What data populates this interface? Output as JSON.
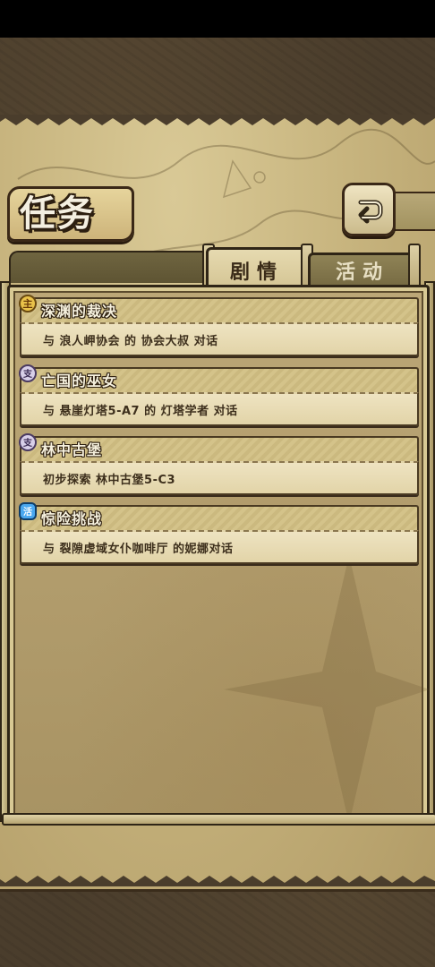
{
  "header": {
    "title": "任务",
    "back_icon": "return-arrow-icon"
  },
  "tabs": [
    {
      "label": "剧情",
      "active": true
    },
    {
      "label": "活动",
      "active": false
    }
  ],
  "quests": [
    {
      "name": "深渊的裁决",
      "description": "与 浪人岬协会 的 协会大叔 对话",
      "icon": "main-quest-icon",
      "icon_color": "#c99a2e"
    },
    {
      "name": "亡国的巫女",
      "description": "与 悬崖灯塔5-A7 的 灯塔学者 对话",
      "icon": "side-quest-icon",
      "icon_color": "#b8a8d8"
    },
    {
      "name": "林中古堡",
      "description": "初步探索 林中古堡5-C3",
      "icon": "side-quest-icon",
      "icon_color": "#b8a8d8"
    },
    {
      "name": "惊险挑战",
      "description": "与 裂隙虚域女仆咖啡厅 的妮娜对话",
      "icon": "challenge-quest-icon",
      "icon_color": "#3a8fd8"
    }
  ],
  "colors": {
    "parchment": "#c8b57f",
    "ink": "#2f2516",
    "card": "#eee3c1"
  }
}
